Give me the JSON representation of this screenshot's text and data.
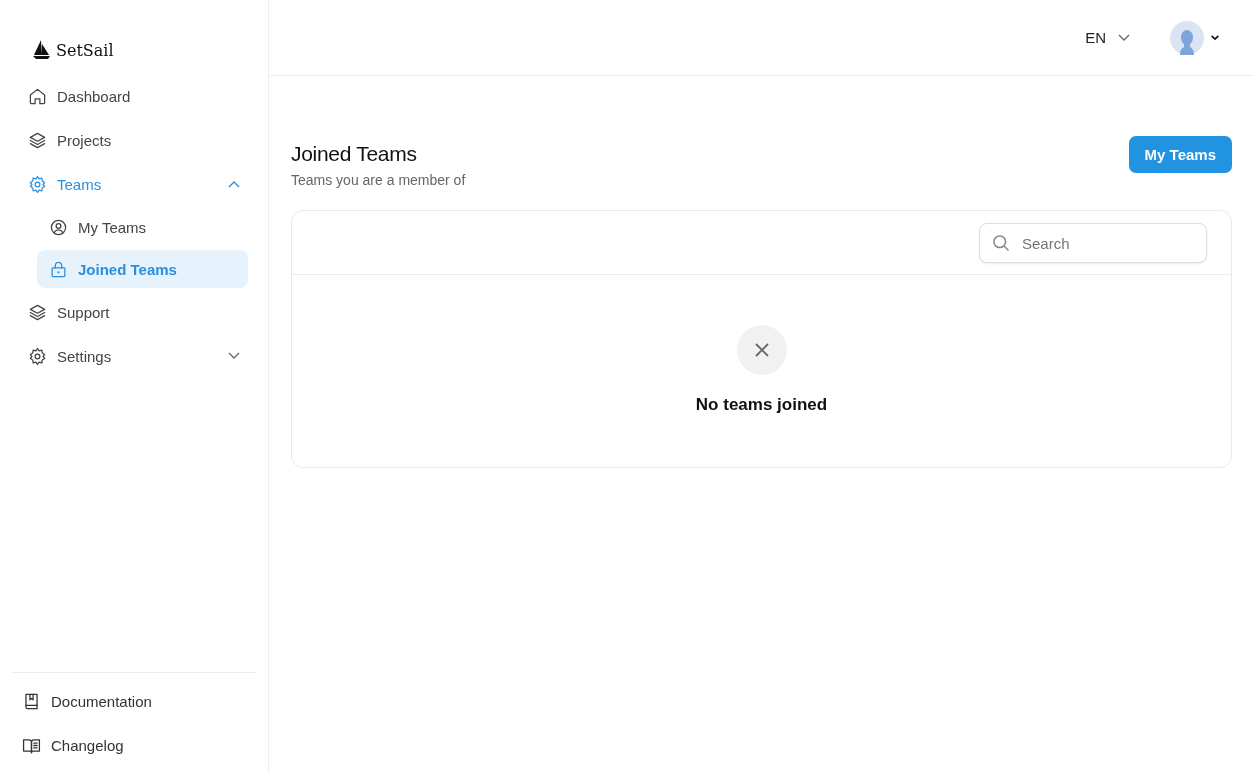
{
  "sidebar": {
    "logo": "SetSail",
    "items": [
      {
        "label": "Dashboard",
        "kind": "home",
        "selected": false
      },
      {
        "label": "Projects",
        "kind": "layers",
        "selected": false
      },
      {
        "label": "Teams",
        "kind": "gear",
        "selected": false,
        "active": true,
        "expanded": true,
        "children": [
          {
            "label": "My Teams",
            "kind": "user",
            "selected": false
          },
          {
            "label": "Joined Teams",
            "kind": "lock",
            "selected": true
          }
        ]
      },
      {
        "label": "Support",
        "kind": "layers",
        "selected": false
      },
      {
        "label": "Settings",
        "kind": "gear",
        "selected": false,
        "active": false,
        "expanded": false
      }
    ],
    "footer_links": [
      {
        "label": "Documentation",
        "kind": "book"
      },
      {
        "label": "Changelog",
        "kind": "book-open"
      }
    ]
  },
  "header": {
    "language": "EN"
  },
  "page": {
    "title": "Joined Teams",
    "subtitle": "Teams you are a member of",
    "button": "My Teams",
    "search": {
      "placeholder": "Search"
    },
    "empty_state": {
      "message": "No teams joined"
    }
  }
}
